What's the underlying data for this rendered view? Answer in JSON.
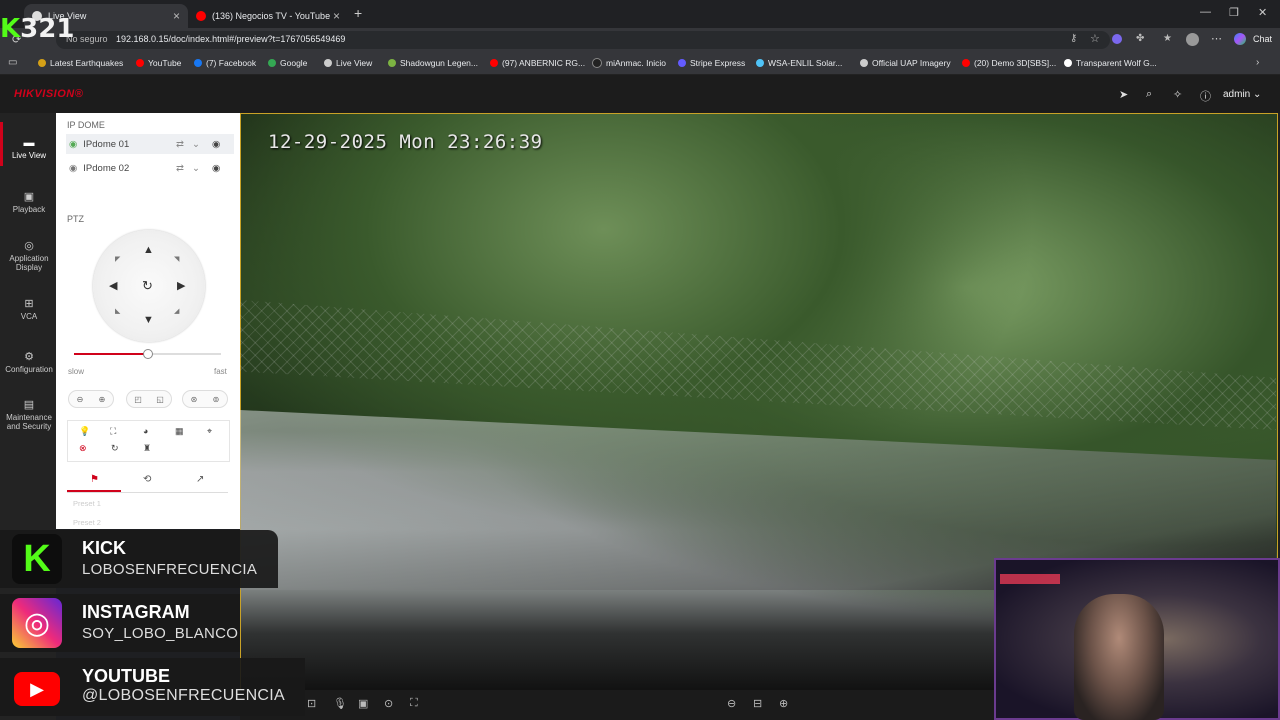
{
  "browser": {
    "tabs": [
      {
        "label": "Live View",
        "active": true
      },
      {
        "label": "(136) Negocios TV - YouTube",
        "active": false
      }
    ],
    "new_tab": "+",
    "url_prefix": "No seguro",
    "url": "192.168.0.15/doc/index.html#/preview?t=1767056549469",
    "chat_label": "Chat",
    "bookmarks": [
      {
        "label": "Latest Earthquakes",
        "color": "#d4a017"
      },
      {
        "label": "YouTube",
        "color": "#ff0000"
      },
      {
        "label": "(7) Facebook",
        "color": "#1877f2"
      },
      {
        "label": "Google",
        "color": "#34a853"
      },
      {
        "label": "Live View",
        "color": "#cccccc"
      },
      {
        "label": "Shadowgun Legen...",
        "color": "#7cb342"
      },
      {
        "label": "(97) ANBERNIC RG...",
        "color": "#ff0000"
      },
      {
        "label": "miAnmac. Inicio",
        "color": "#222222"
      },
      {
        "label": "Stripe Express",
        "color": "#635bff"
      },
      {
        "label": "WSA-ENLIL Solar...",
        "color": "#4fc3f7"
      },
      {
        "label": "Official UAP Imagery",
        "color": "#cccccc"
      },
      {
        "label": "(20) Demo 3D[SBS]...",
        "color": "#ff0000"
      },
      {
        "label": "Transparent Wolf G...",
        "color": "#ffffff"
      }
    ]
  },
  "app": {
    "logo": "HIKVISION®",
    "user": "admin",
    "nav": [
      {
        "label": "Live View",
        "icon": "live-view-icon"
      },
      {
        "label": "Playback",
        "icon": "playback-icon"
      },
      {
        "label": "Application Display",
        "icon": "application-icon"
      },
      {
        "label": "VCA",
        "icon": "vca-icon"
      },
      {
        "label": "Configuration",
        "icon": "gear-icon"
      },
      {
        "label": "Maintenance and Security",
        "icon": "maintenance-icon"
      }
    ],
    "group_title": "IP DOME",
    "devices": [
      "IPdome 01",
      "IPdome 02"
    ],
    "ptz_title": "PTZ",
    "speed_slow": "slow",
    "speed_fast": "fast",
    "speed_value": 0.5,
    "presets": [
      "Preset 1",
      "Preset 2"
    ],
    "accent_color": "#d0021b"
  },
  "video": {
    "osd": "12-29-2025 Mon 23:26:39"
  },
  "overlay": {
    "stream_id": "321",
    "socials": [
      {
        "name": "KICK",
        "handle": "LOBOSENFRECUENCIA",
        "icon": "kick-icon"
      },
      {
        "name": "INSTAGRAM",
        "handle": "SOY_LOBO_BLANCO",
        "icon": "instagram-icon"
      },
      {
        "name": "YOUTUBE",
        "handle": "@LOBOSENFRECUENCIA",
        "icon": "youtube-icon"
      }
    ]
  }
}
